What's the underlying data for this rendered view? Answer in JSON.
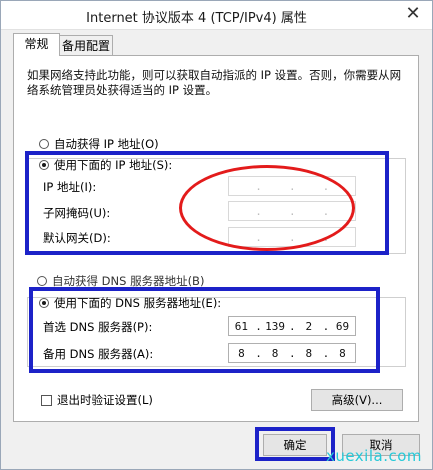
{
  "window": {
    "title": "Internet 协议版本 4 (TCP/IPv4) 属性",
    "close_label": "✕"
  },
  "tabs": [
    {
      "label": "常规"
    },
    {
      "label": "备用配置"
    }
  ],
  "description": "如果网络支持此功能，则可以获取自动指派的 IP 设置。否则，你需要从网络系统管理员处获得适当的 IP 设置。",
  "ip_section": {
    "auto_label": "自动获得 IP 地址(O)",
    "manual_label": "使用下面的 IP 地址(S):",
    "fields": [
      {
        "label": "IP 地址(I):",
        "octets": [
          "",
          "",
          "",
          ""
        ]
      },
      {
        "label": "子网掩码(U):",
        "octets": [
          "",
          "",
          "",
          ""
        ]
      },
      {
        "label": "默认网关(D):",
        "octets": [
          "",
          "",
          "",
          ""
        ]
      }
    ]
  },
  "dns_section": {
    "auto_label": "自动获得 DNS 服务器地址(B)",
    "manual_label": "使用下面的 DNS 服务器地址(E):",
    "fields": [
      {
        "label": "首选 DNS 服务器(P):",
        "octets": [
          "61",
          "139",
          "2",
          "69"
        ]
      },
      {
        "label": "备用 DNS 服务器(A):",
        "octets": [
          "8",
          "8",
          "8",
          "8"
        ]
      }
    ]
  },
  "validate_label": "退出时验证设置(L)",
  "advanced_label": "高级(V)...",
  "ok_label": "确定",
  "cancel_label": "取消",
  "watermark": "xuexila.com",
  "colors": {
    "highlight_blue": "#1c22c8",
    "highlight_red": "#e31b1b"
  }
}
